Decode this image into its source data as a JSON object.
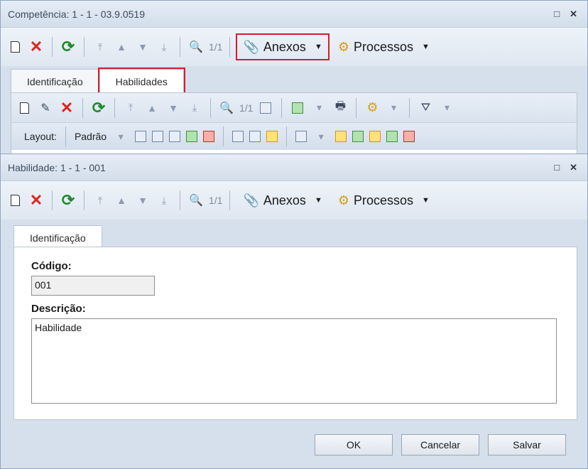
{
  "back_window": {
    "title": "Competência: 1 - 1 - 03.9.0519",
    "controls": {
      "restore": "□",
      "close": "✕"
    },
    "toolbar": {
      "counter": "1/1",
      "attachments_label": "Anexos",
      "processes_label": "Processos"
    },
    "tabs": [
      {
        "label": "Identificação"
      },
      {
        "label": "Habilidades"
      }
    ],
    "inner_toolbar": {
      "counter": "1/1"
    },
    "layout_toolbar": {
      "layout_label": "Layout:",
      "preset_label": "Padrão"
    }
  },
  "front_window": {
    "title": "Habilidade: 1 - 1 - 001",
    "controls": {
      "restore": "□",
      "close": "✕"
    },
    "toolbar": {
      "counter": "1/1",
      "attachments_label": "Anexos",
      "processes_label": "Processos"
    },
    "tab": {
      "label": "Identificação"
    },
    "form": {
      "code_label": "Código:",
      "code_value": "001",
      "description_label": "Descrição:",
      "description_value": "Habilidade"
    },
    "buttons": {
      "ok": "OK",
      "cancel": "Cancelar",
      "save": "Salvar"
    }
  },
  "colors": {
    "highlight": "#d21f2a",
    "window_bg": "#d6e0ec"
  }
}
